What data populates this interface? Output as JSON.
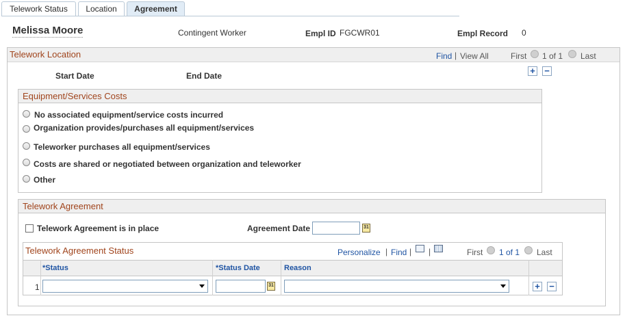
{
  "tabs": [
    {
      "label": "Telework Status"
    },
    {
      "label": "Location"
    },
    {
      "label": "Agreement"
    }
  ],
  "header": {
    "employee_name": "Melissa Moore",
    "worker_type": "Contingent Worker",
    "empl_id_label": "Empl ID",
    "empl_id_value": "FGCWR01",
    "empl_record_label": "Empl Record",
    "empl_record_value": "0"
  },
  "telework_location": {
    "title": "Telework Location",
    "find": "Find",
    "view_all": "View All",
    "first": "First",
    "count": "1 of 1",
    "last": "Last",
    "start_date_label": "Start Date",
    "end_date_label": "End Date"
  },
  "equipment": {
    "title": "Equipment/Services Costs",
    "options": [
      "No associated equipment/service costs incurred",
      "Organization provides/purchases all equipment/services",
      "Teleworker purchases all equipment/services",
      "Costs are shared or negotiated between organization and teleworker",
      "Other"
    ]
  },
  "agreement": {
    "title": "Telework Agreement",
    "in_place_label": "Telework Agreement is in place",
    "in_place_checked": false,
    "agreement_date_label": "Agreement Date",
    "agreement_date_value": ""
  },
  "status_grid": {
    "title": "Telework Agreement Status",
    "personalize": "Personalize",
    "find": "Find",
    "first": "First",
    "count": "1 of 1",
    "last": "Last",
    "columns": {
      "status": "*Status",
      "status_date": "*Status Date",
      "reason": "Reason"
    },
    "rows": [
      {
        "num": "1",
        "status": "",
        "status_date": "",
        "reason": ""
      }
    ]
  },
  "icons": {
    "calendar": "calendar-icon",
    "add": "add-row-icon",
    "delete": "delete-row-icon",
    "prev": "previous-icon",
    "next": "next-icon",
    "zoom": "view-in-new-window-icon",
    "download": "download-grid-icon"
  },
  "colors": {
    "section_title": "#a0441c",
    "link": "#1f54a3",
    "tab_active_bg": "#e1ecf6"
  }
}
